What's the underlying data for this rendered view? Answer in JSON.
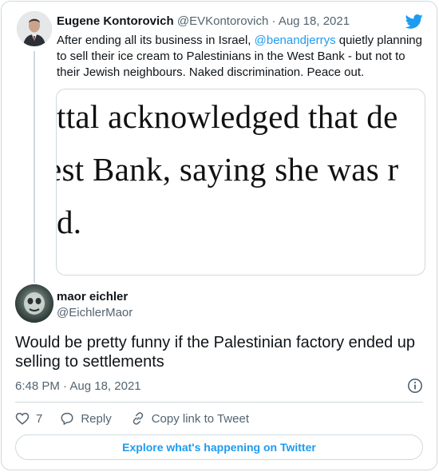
{
  "parent_tweet": {
    "author_name": "Eugene Kontorovich",
    "handle": "@EVKontorovich",
    "separator": "·",
    "date": "Aug 18, 2021",
    "text_before_mention": "After ending all its business in Israel, ",
    "mention": "@benandjerrys",
    "text_after_mention": " quietly planning to sell their ice cream to Palestinians in the West Bank - but not to their Jewish neighbours. Naked discrimination. Peace out.",
    "media_text": {
      "line1": "ttal acknowledged that de",
      "line2": "est Bank, saying she was r",
      "line3": "d."
    }
  },
  "main_tweet": {
    "author_name": "maor eichler",
    "handle": "@EichlerMaor",
    "text": "Would be pretty funny if the Palestinian factory ended up selling to settlements",
    "time": "6:48 PM",
    "separator": "·",
    "date": "Aug 18, 2021"
  },
  "actions": {
    "like_count": "7",
    "reply_label": "Reply",
    "copy_link_label": "Copy link to Tweet"
  },
  "explore_label": "Explore what's happening on Twitter",
  "colors": {
    "accent": "#1d9bf0",
    "text": "#0f1419",
    "secondary": "#536471",
    "border": "#cfd9de"
  },
  "icons": {
    "brand": "twitter-bird-icon",
    "info": "info-icon",
    "like": "heart-icon",
    "reply": "reply-bubble-icon",
    "copy_link": "link-icon"
  }
}
